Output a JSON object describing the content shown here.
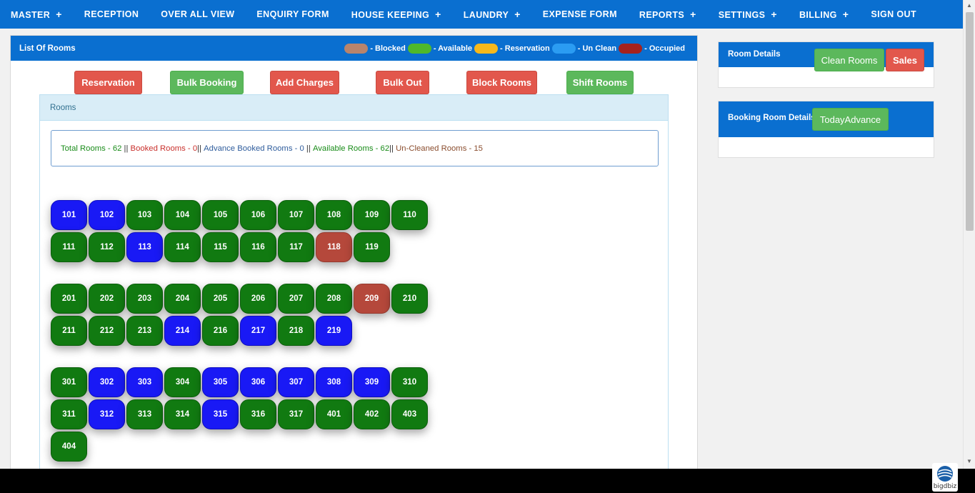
{
  "nav": [
    {
      "label": "MASTER",
      "plus": "+"
    },
    {
      "label": "RECEPTION",
      "plus": ""
    },
    {
      "label": "OVER ALL VIEW",
      "plus": ""
    },
    {
      "label": "ENQUIRY FORM",
      "plus": ""
    },
    {
      "label": "HOUSE KEEPING",
      "plus": "+"
    },
    {
      "label": "LAUNDRY",
      "plus": "+"
    },
    {
      "label": "EXPENSE FORM",
      "plus": ""
    },
    {
      "label": "REPORTS",
      "plus": "+"
    },
    {
      "label": "SETTINGS",
      "plus": "+"
    },
    {
      "label": "BILLING",
      "plus": "+"
    },
    {
      "label": "SIGN OUT",
      "plus": ""
    }
  ],
  "main": {
    "title": "List Of Rooms",
    "legend": [
      {
        "color": "#b8846c",
        "label": "- Blocked"
      },
      {
        "color": "#4fb82b",
        "label": "- Available"
      },
      {
        "color": "#f6b81c",
        "label": "- Reservation"
      },
      {
        "color": "#2b9cf2",
        "label": "- Un Clean"
      },
      {
        "color": "#a5221e",
        "label": "- Occupied"
      }
    ],
    "buttons": {
      "reservation": "Reservation",
      "bulk_booking": "Bulk Booking",
      "add_charges": "Add Charges",
      "bulk_out": "Bulk Out",
      "block_rooms": "Block Rooms",
      "shift_rooms": "Shift Rooms"
    },
    "rooms_heading": "Rooms",
    "summary": {
      "total": "Total Rooms - 62",
      "sep1": " || ",
      "booked": "Booked Rooms - 0",
      "sep2": "|| ",
      "advance": "Advance Booked Rooms - 0",
      "sep3": " || ",
      "available": "Available Rooms - 62",
      "sep4": "|| ",
      "uncleaned": "Un-Cleaned Rooms - 15"
    }
  },
  "room_groups": [
    {
      "rows": [
        [
          {
            "n": "101",
            "s": "unclean"
          },
          {
            "n": "102",
            "s": "unclean"
          },
          {
            "n": "103",
            "s": "available"
          },
          {
            "n": "104",
            "s": "available"
          },
          {
            "n": "105",
            "s": "available"
          },
          {
            "n": "106",
            "s": "available"
          },
          {
            "n": "107",
            "s": "available"
          },
          {
            "n": "108",
            "s": "available"
          },
          {
            "n": "109",
            "s": "available"
          },
          {
            "n": "110",
            "s": "available"
          }
        ],
        [
          {
            "n": "111",
            "s": "available"
          },
          {
            "n": "112",
            "s": "available"
          },
          {
            "n": "113",
            "s": "unclean"
          },
          {
            "n": "114",
            "s": "available"
          },
          {
            "n": "115",
            "s": "available"
          },
          {
            "n": "116",
            "s": "available"
          },
          {
            "n": "117",
            "s": "available"
          },
          {
            "n": "118",
            "s": "occupied"
          },
          {
            "n": "119",
            "s": "available"
          }
        ]
      ]
    },
    {
      "rows": [
        [
          {
            "n": "201",
            "s": "available"
          },
          {
            "n": "202",
            "s": "available"
          },
          {
            "n": "203",
            "s": "available"
          },
          {
            "n": "204",
            "s": "available"
          },
          {
            "n": "205",
            "s": "available"
          },
          {
            "n": "206",
            "s": "available"
          },
          {
            "n": "207",
            "s": "available"
          },
          {
            "n": "208",
            "s": "available"
          },
          {
            "n": "209",
            "s": "occupied"
          },
          {
            "n": "210",
            "s": "available"
          }
        ],
        [
          {
            "n": "211",
            "s": "available"
          },
          {
            "n": "212",
            "s": "available"
          },
          {
            "n": "213",
            "s": "available"
          },
          {
            "n": "214",
            "s": "unclean"
          },
          {
            "n": "216",
            "s": "available"
          },
          {
            "n": "217",
            "s": "unclean"
          },
          {
            "n": "218",
            "s": "available"
          },
          {
            "n": "219",
            "s": "unclean"
          }
        ]
      ]
    },
    {
      "rows": [
        [
          {
            "n": "301",
            "s": "available"
          },
          {
            "n": "302",
            "s": "unclean"
          },
          {
            "n": "303",
            "s": "unclean"
          },
          {
            "n": "304",
            "s": "available"
          },
          {
            "n": "305",
            "s": "unclean"
          },
          {
            "n": "306",
            "s": "unclean"
          },
          {
            "n": "307",
            "s": "unclean"
          },
          {
            "n": "308",
            "s": "unclean"
          },
          {
            "n": "309",
            "s": "unclean"
          },
          {
            "n": "310",
            "s": "available"
          }
        ],
        [
          {
            "n": "311",
            "s": "available"
          },
          {
            "n": "312",
            "s": "unclean"
          },
          {
            "n": "313",
            "s": "available"
          },
          {
            "n": "314",
            "s": "available"
          },
          {
            "n": "315",
            "s": "unclean"
          },
          {
            "n": "316",
            "s": "available"
          },
          {
            "n": "317",
            "s": "available"
          },
          {
            "n": "401",
            "s": "available"
          },
          {
            "n": "402",
            "s": "available"
          },
          {
            "n": "403",
            "s": "available"
          }
        ],
        [
          {
            "n": "404",
            "s": "available"
          }
        ]
      ]
    }
  ],
  "room_details": {
    "title": "Room Details",
    "clean_rooms": "Clean Rooms",
    "sales": "Sales"
  },
  "booking_room_details": {
    "title": "Booking Room Details",
    "today_advance": "TodayAdvance"
  },
  "logo": {
    "name": "bigdbiz"
  }
}
